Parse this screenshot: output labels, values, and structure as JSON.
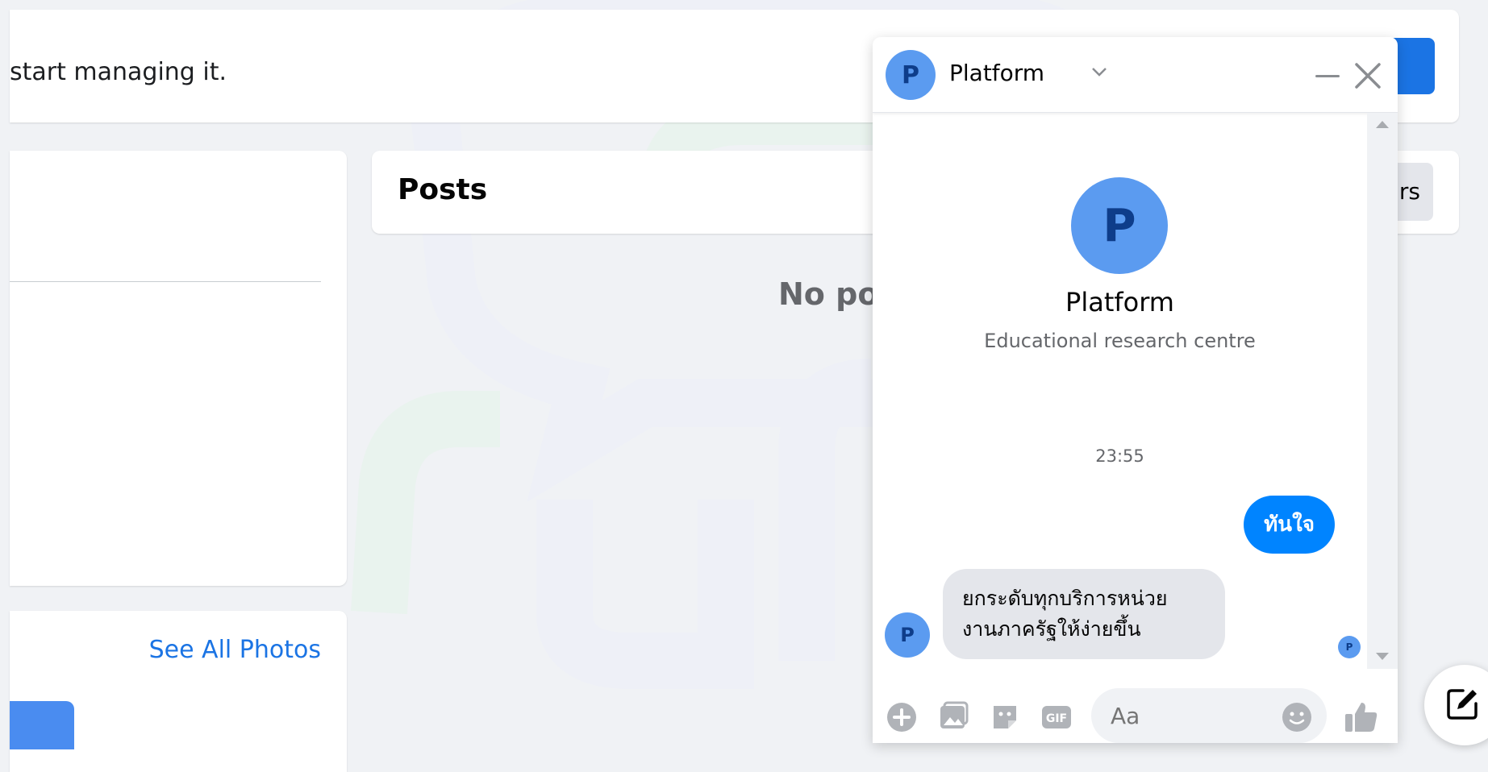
{
  "page": {
    "manage_message": "start managing it.",
    "posts_title": "Posts",
    "filters_label": "rs",
    "no_posts_text": "No po",
    "see_all_photos": "See All Photos"
  },
  "chat": {
    "header_name": "Platform",
    "avatar_letter": "P",
    "profile_name": "Platform",
    "profile_subtitle": "Educational research centre",
    "timestamp": "23:55",
    "outgoing_message": "ทันใจ",
    "incoming_message_line1": "ยกระดับทุกบริการหน่วย",
    "incoming_message_line2": "งานภาครัฐให้ง่ายขึ้น",
    "input_placeholder": "Aa",
    "icons": [
      "plus-icon",
      "image-icon",
      "sticker-icon",
      "gif-icon",
      "emoji-icon",
      "thumbs-up-icon",
      "chevron-down-icon",
      "minimize-icon",
      "close-icon",
      "new-message-icon"
    ]
  },
  "colors": {
    "accent": "#0084ff",
    "brand_blue": "#1b74e4",
    "avatar_bg": "#5b9bf0",
    "page_bg": "#f0f2f5"
  }
}
